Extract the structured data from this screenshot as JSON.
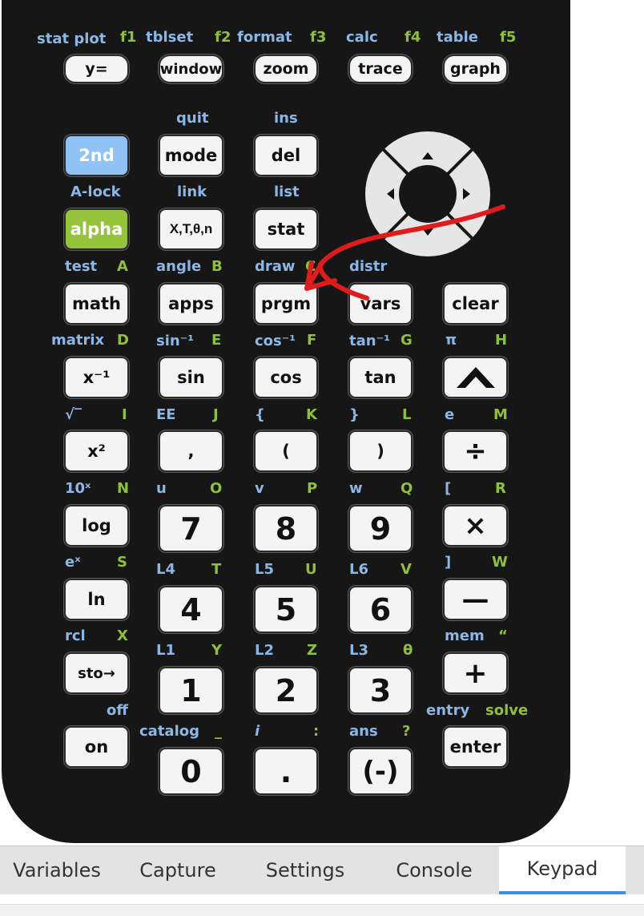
{
  "keypad": {
    "top_row": [
      {
        "key": "y=",
        "second": "stat plot",
        "fn": "f1"
      },
      {
        "key": "window",
        "second": "tblset",
        "fn": "f2"
      },
      {
        "key": "zoom",
        "second": "format",
        "fn": "f3"
      },
      {
        "key": "trace",
        "second": "calc",
        "fn": "f4"
      },
      {
        "key": "graph",
        "second": "table",
        "fn": "f5"
      }
    ],
    "row1": {
      "second_key": "2nd",
      "mode": "mode",
      "mode_second": "quit",
      "del": "del",
      "del_second": "ins"
    },
    "row2": {
      "alpha": "alpha",
      "alpha_second": "A-lock",
      "xt": "X,T,θ,n",
      "xt_second": "link",
      "stat": "stat",
      "stat_second": "list"
    },
    "row3": [
      {
        "key": "math",
        "second": "test",
        "alpha": "A"
      },
      {
        "key": "apps",
        "second": "angle",
        "alpha": "B"
      },
      {
        "key": "prgm",
        "second": "draw",
        "alpha": "C"
      },
      {
        "key": "vars",
        "second": "distr",
        "alpha": ""
      },
      {
        "key": "clear",
        "second": "",
        "alpha": ""
      }
    ],
    "row4": [
      {
        "key": "x⁻¹",
        "second": "matrix",
        "alpha": "D"
      },
      {
        "key": "sin",
        "second": "sin⁻¹",
        "alpha": "E"
      },
      {
        "key": "cos",
        "second": "cos⁻¹",
        "alpha": "F"
      },
      {
        "key": "tan",
        "second": "tan⁻¹",
        "alpha": "G"
      },
      {
        "key": "^",
        "second": "π",
        "alpha": "H"
      }
    ],
    "row5": [
      {
        "key": "x²",
        "second": "√‾",
        "alpha": "I"
      },
      {
        "key": ",",
        "second": "EE",
        "alpha": "J"
      },
      {
        "key": "(",
        "second": "{",
        "alpha": "K"
      },
      {
        "key": ")",
        "second": "}",
        "alpha": "L"
      },
      {
        "key": "÷",
        "second": "e",
        "alpha": "M"
      }
    ],
    "row6": [
      {
        "key": "log",
        "second": "10ˣ",
        "alpha": "N"
      },
      {
        "key": "7",
        "second": "u",
        "alpha": "O"
      },
      {
        "key": "8",
        "second": "v",
        "alpha": "P"
      },
      {
        "key": "9",
        "second": "w",
        "alpha": "Q"
      },
      {
        "key": "×",
        "second": "[",
        "alpha": "R"
      }
    ],
    "row7": [
      {
        "key": "ln",
        "second": "eˣ",
        "alpha": "S"
      },
      {
        "key": "4",
        "second": "L4",
        "alpha": "T"
      },
      {
        "key": "5",
        "second": "L5",
        "alpha": "U"
      },
      {
        "key": "6",
        "second": "L6",
        "alpha": "V"
      },
      {
        "key": "—",
        "second": "]",
        "alpha": "W"
      }
    ],
    "row8": [
      {
        "key": "sto→",
        "second": "rcl",
        "alpha": "X"
      },
      {
        "key": "1",
        "second": "L1",
        "alpha": "Y"
      },
      {
        "key": "2",
        "second": "L2",
        "alpha": "Z"
      },
      {
        "key": "3",
        "second": "L3",
        "alpha": "θ"
      },
      {
        "key": "+",
        "second": "mem",
        "alpha": "“"
      }
    ],
    "row9": [
      {
        "key": "on",
        "second": "off",
        "alpha": ""
      },
      {
        "key": "0",
        "second": "catalog",
        "alpha": "_"
      },
      {
        "key": ".",
        "second": "i",
        "alpha": ":"
      },
      {
        "key": "(-)",
        "second": "ans",
        "alpha": "?"
      },
      {
        "key": "enter",
        "second": "entry",
        "alpha": "solve"
      }
    ],
    "colors": {
      "body": "#161616",
      "key": "#f4f4f4",
      "second_label": "#8ab7e6",
      "alpha_label": "#8fc03a",
      "second_key": "#8fc3f6",
      "alpha_key": "#95c43a",
      "annotation": "#e01b1b"
    }
  },
  "tabs": [
    {
      "label": "Variables",
      "active": false
    },
    {
      "label": "Capture",
      "active": false
    },
    {
      "label": "Settings",
      "active": false
    },
    {
      "label": "Console",
      "active": false
    },
    {
      "label": "Keypad",
      "active": true
    }
  ],
  "annotation": {
    "type": "red-arrow",
    "points_to": "prgm"
  }
}
